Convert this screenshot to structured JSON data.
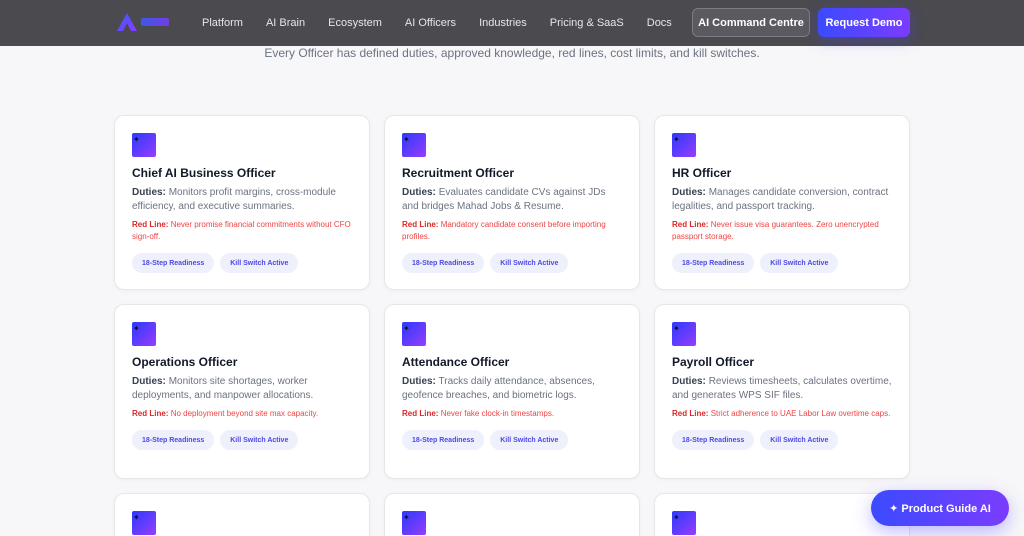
{
  "nav": {
    "links": [
      "Platform",
      "AI Brain",
      "Ecosystem",
      "AI Officers",
      "Industries",
      "Pricing & SaaS",
      "Docs"
    ],
    "command_centre": "AI Command Centre",
    "request_demo": "Request Demo"
  },
  "subtitle": "Every Officer has defined duties, approved knowledge, red lines, cost limits, and kill switches.",
  "labels": {
    "duties": "Duties:",
    "red_line": "Red Line:"
  },
  "pills": {
    "readiness": "18-Step Readiness",
    "kill_switch": "Kill Switch Active"
  },
  "cards": [
    {
      "title": "Chief AI Business Officer",
      "duties": "Monitors profit margins, cross-module efficiency, and executive summaries.",
      "red_line": "Never promise financial commitments without CFO sign-off."
    },
    {
      "title": "Recruitment Officer",
      "duties": "Evaluates candidate CVs against JDs and bridges Mahad Jobs & Resume.",
      "red_line": "Mandatory candidate consent before importing profiles."
    },
    {
      "title": "HR Officer",
      "duties": "Manages candidate conversion, contract legalities, and passport tracking.",
      "red_line": "Never issue visa guarantees. Zero unencrypted passport storage."
    },
    {
      "title": "Operations Officer",
      "duties": "Monitors site shortages, worker deployments, and manpower allocations.",
      "red_line": "No deployment beyond site max capacity."
    },
    {
      "title": "Attendance Officer",
      "duties": "Tracks daily attendance, absences, geofence breaches, and biometric logs.",
      "red_line": "Never fake clock-in timestamps."
    },
    {
      "title": "Payroll Officer",
      "duties": "Reviews timesheets, calculates overtime, and generates WPS SIF files.",
      "red_line": "Strict adherence to UAE Labor Law overtime caps."
    }
  ],
  "fab": "✦ Product Guide AI"
}
